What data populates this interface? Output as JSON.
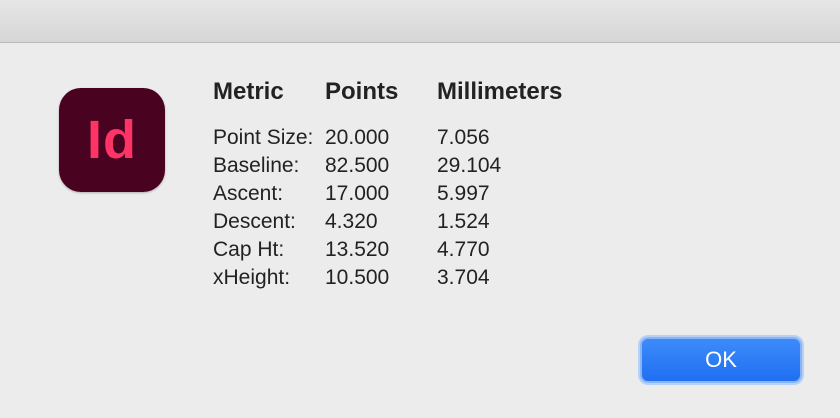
{
  "app_icon": {
    "label": "Id",
    "background_color": "#49021f",
    "text_color": "#ff3366"
  },
  "table": {
    "headers": {
      "metric": "Metric",
      "points": "Points",
      "millimeters": "Millimeters"
    },
    "rows": [
      {
        "metric": "Point Size:",
        "points": "20.000",
        "millimeters": "7.056"
      },
      {
        "metric": "Baseline:",
        "points": "82.500",
        "millimeters": "29.104"
      },
      {
        "metric": "Ascent:",
        "points": "17.000",
        "millimeters": "5.997"
      },
      {
        "metric": "Descent:",
        "points": "4.320",
        "millimeters": "1.524"
      },
      {
        "metric": "Cap Ht:",
        "points": "13.520",
        "millimeters": "4.770"
      },
      {
        "metric": "xHeight:",
        "points": "10.500",
        "millimeters": "3.704"
      }
    ]
  },
  "buttons": {
    "ok_label": "OK",
    "accent_color": "#2a7cf6"
  }
}
